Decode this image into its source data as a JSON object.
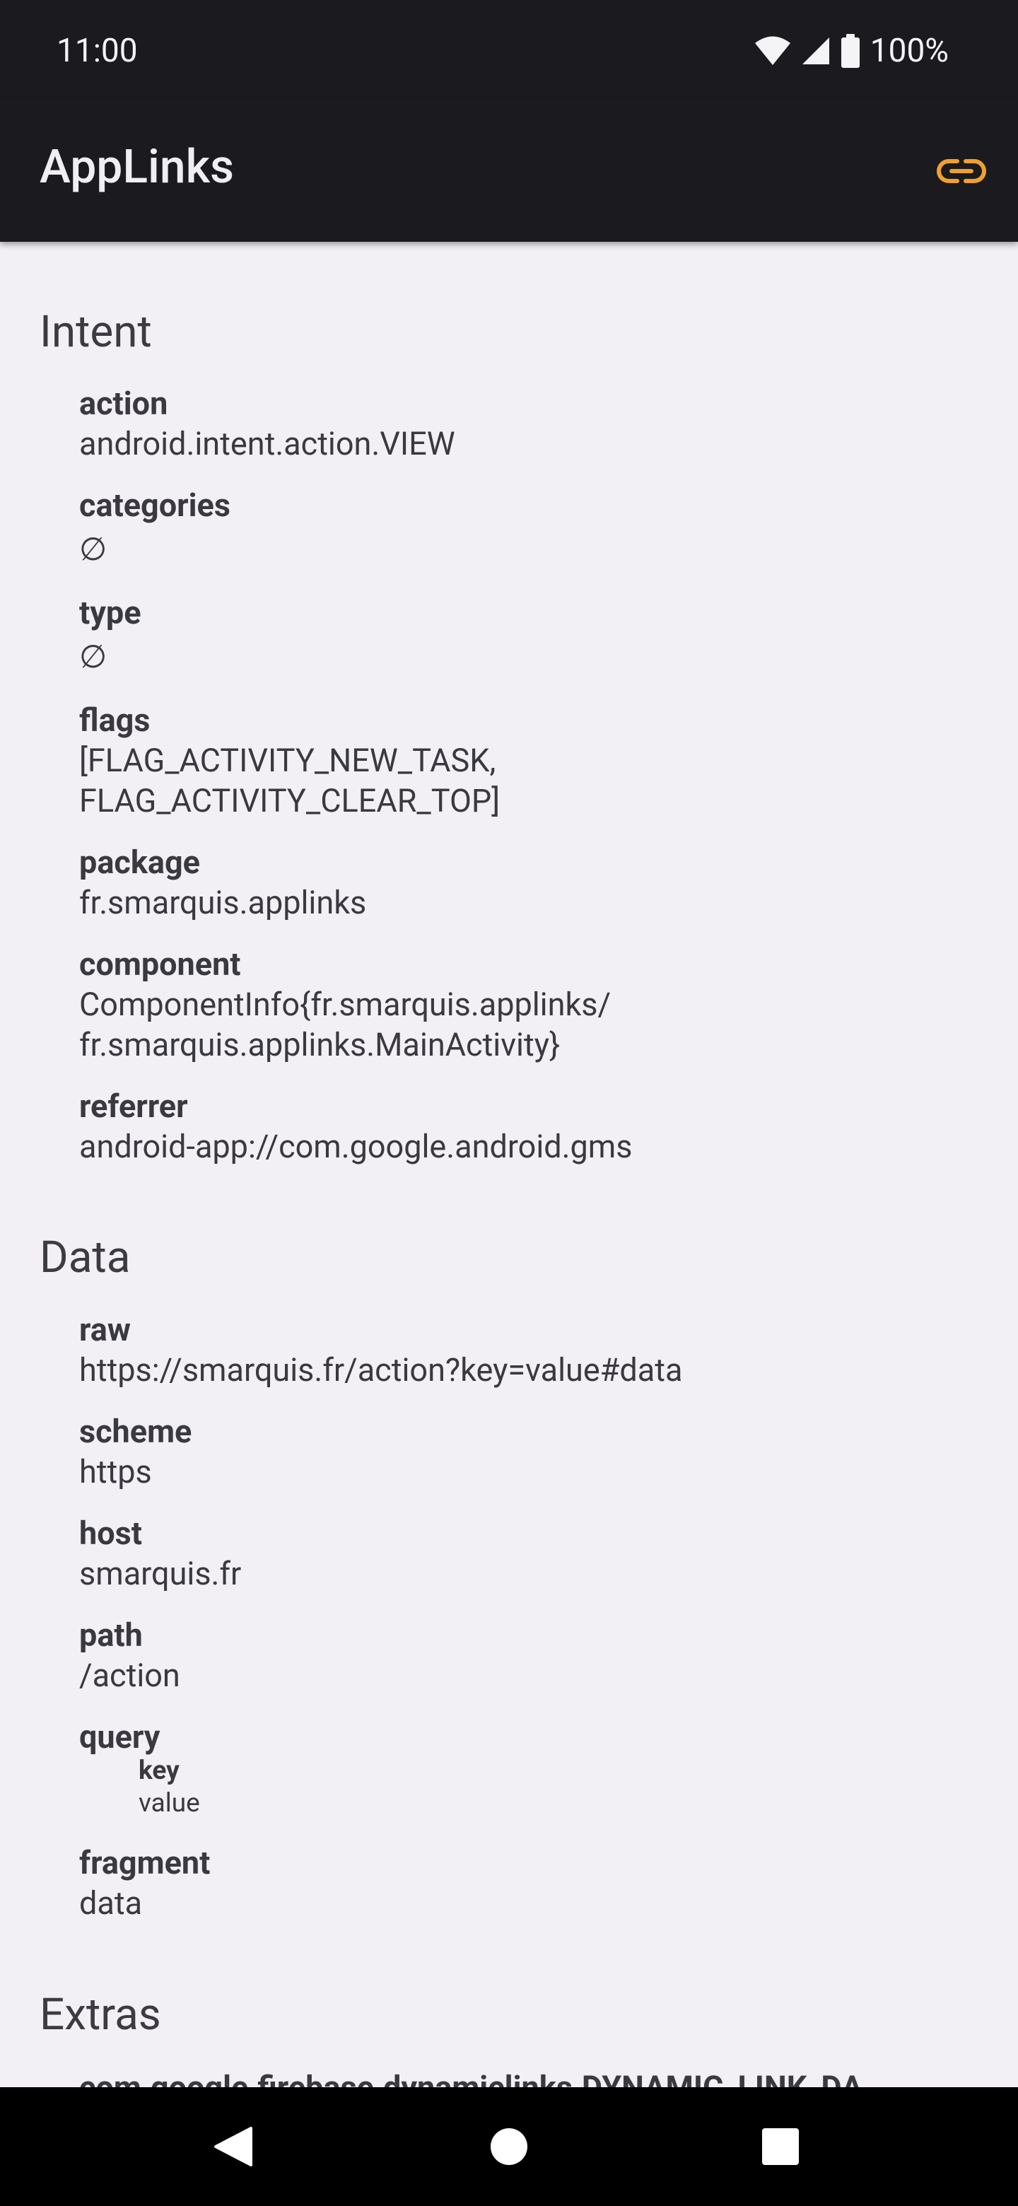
{
  "status_bar": {
    "time": "11:00",
    "battery": "100%"
  },
  "app_bar": {
    "title": "AppLinks",
    "link_icon": "link-icon",
    "accent": "#f0a030"
  },
  "intent": {
    "title": "Intent",
    "action": {
      "key": "action",
      "value": "android.intent.action.VIEW"
    },
    "categories": {
      "key": "categories",
      "value": "∅"
    },
    "type": {
      "key": "type",
      "value": "∅"
    },
    "flags": {
      "key": "flags",
      "value": "[FLAG_ACTIVITY_NEW_TASK,\nFLAG_ACTIVITY_CLEAR_TOP]"
    },
    "package": {
      "key": "package",
      "value": "fr.smarquis.applinks"
    },
    "component": {
      "key": "component",
      "value": "ComponentInfo{fr.smarquis.applinks/\nfr.smarquis.applinks.MainActivity}"
    },
    "referrer": {
      "key": "referrer",
      "value": "android-app://com.google.android.gms"
    }
  },
  "data": {
    "title": "Data",
    "raw": {
      "key": "raw",
      "value": "https://smarquis.fr/action?key=value#data"
    },
    "scheme": {
      "key": "scheme",
      "value": "https"
    },
    "host": {
      "key": "host",
      "value": "smarquis.fr"
    },
    "path": {
      "key": "path",
      "value": "/action"
    },
    "query": {
      "key": "query",
      "param_key": "key",
      "param_value": "value"
    },
    "fragment": {
      "key": "fragment",
      "value": "data"
    }
  },
  "extras": {
    "title": "Extras",
    "first_key": "com.google.firebase.dynamiclinks.DYNAMIC_LINK_DA"
  },
  "nav_bar": {
    "back": "back-icon",
    "home": "home-icon",
    "recents": "recents-icon"
  }
}
